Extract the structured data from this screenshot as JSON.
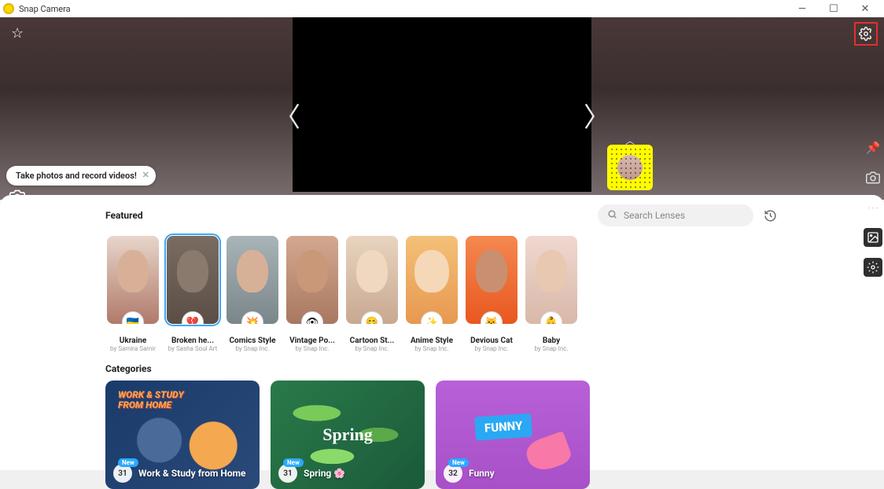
{
  "window": {
    "title": "Snap Camera"
  },
  "tooltip": {
    "text": "Take photos and record videos!"
  },
  "sections": {
    "featured": "Featured",
    "categories": "Categories"
  },
  "search": {
    "placeholder": "Search Lenses"
  },
  "lenses": [
    {
      "name": "Ukraine",
      "author": "by Samira Samir",
      "thumb": "th-ukraine",
      "badge": "🇺🇦",
      "selected": false
    },
    {
      "name": "Broken he...",
      "author": "by Sasha Soul Art",
      "thumb": "th-broken",
      "badge": "💔",
      "selected": true
    },
    {
      "name": "Comics Style",
      "author": "by Snap Inc.",
      "thumb": "th-comics",
      "badge": "💥",
      "selected": false
    },
    {
      "name": "Vintage Po...",
      "author": "by Snap Inc.",
      "thumb": "th-vintage",
      "badge": "👁",
      "selected": false
    },
    {
      "name": "Cartoon St...",
      "author": "by Snap Inc.",
      "thumb": "th-cartoon",
      "badge": "😊",
      "selected": false
    },
    {
      "name": "Anime Style",
      "author": "by Snap Inc.",
      "thumb": "th-anime",
      "badge": "✨",
      "selected": false
    },
    {
      "name": "Devious Cat",
      "author": "by Snap Inc.",
      "thumb": "th-devious",
      "badge": "😼",
      "selected": false
    },
    {
      "name": "Baby",
      "author": "by Snap Inc.",
      "thumb": "th-baby",
      "badge": "👶",
      "selected": false
    }
  ],
  "categories": [
    {
      "label": "Work & Study from Home",
      "count": "31",
      "new": "New",
      "cls": "cat-work",
      "overlay": "WORK & STUDY\nFROM HOME"
    },
    {
      "label": "Spring 🌸",
      "count": "31",
      "new": "New",
      "cls": "cat-spring",
      "overlay": "Spring"
    },
    {
      "label": "Funny",
      "count": "32",
      "new": "New",
      "cls": "cat-funny",
      "overlay": ""
    }
  ]
}
